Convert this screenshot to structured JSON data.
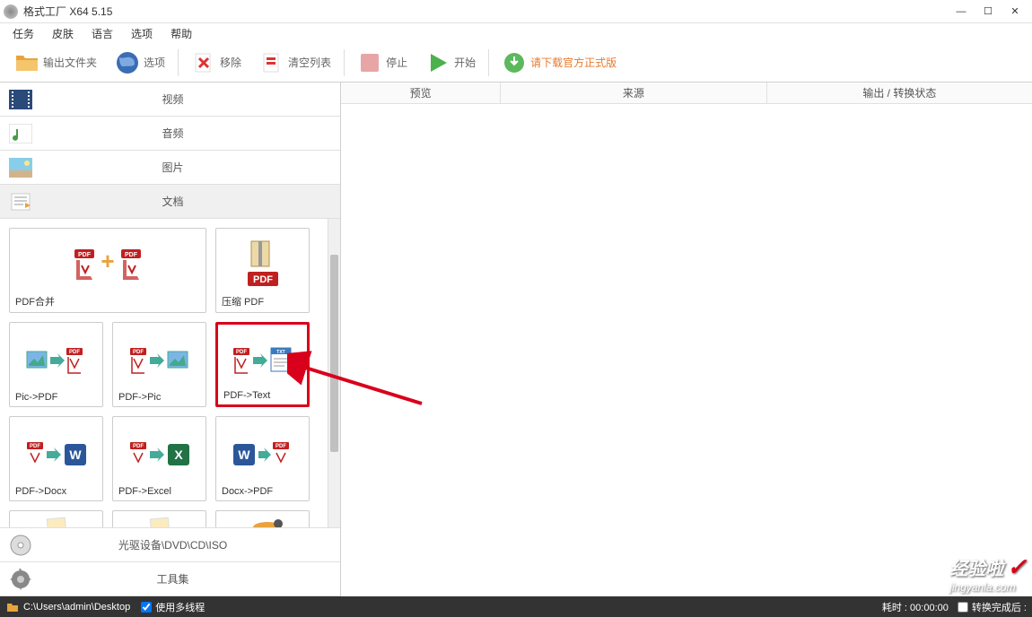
{
  "window": {
    "title": "格式工厂 X64 5.15"
  },
  "menubar": [
    "任务",
    "皮肤",
    "语言",
    "选项",
    "帮助"
  ],
  "toolbar": {
    "output_folder": "输出文件夹",
    "options": "选项",
    "remove": "移除",
    "clear_list": "清空列表",
    "stop": "停止",
    "start": "开始",
    "download_official": "请下载官方正式版"
  },
  "categories": {
    "video": "视频",
    "audio": "音频",
    "image": "图片",
    "document": "文档",
    "optical": "光驱设备\\DVD\\CD\\ISO",
    "tools": "工具集"
  },
  "tiles": {
    "pdf_merge": "PDF合并",
    "compress_pdf": "压缩 PDF",
    "pic_to_pdf": "Pic->PDF",
    "pdf_to_pic": "PDF->Pic",
    "pdf_to_text": "PDF->Text",
    "pdf_to_docx": "PDF->Docx",
    "pdf_to_excel": "PDF->Excel",
    "docx_to_pdf": "Docx->PDF"
  },
  "columns": {
    "preview": "预览",
    "source": "来源",
    "output_status": "输出 / 转换状态"
  },
  "statusbar": {
    "path": "C:\\Users\\admin\\Desktop",
    "multithread": "使用多线程",
    "elapsed": "耗时 : 00:00:00",
    "after_convert": "转换完成后 :"
  },
  "watermark": {
    "main": "经验啦",
    "sub": "jingyanla.com"
  }
}
